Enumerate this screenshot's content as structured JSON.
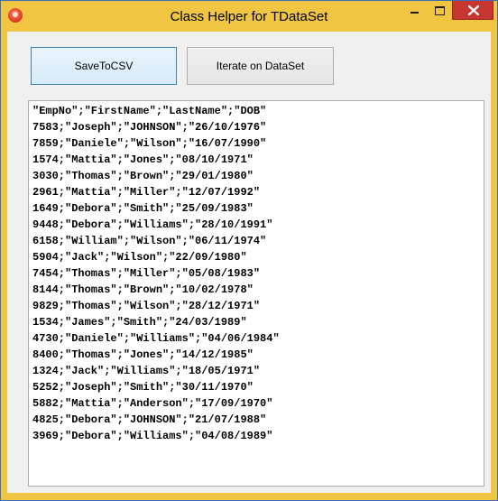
{
  "window": {
    "title": "Class Helper for TDataSet"
  },
  "toolbar": {
    "save_label": "SaveToCSV",
    "iterate_label": "Iterate on DataSet"
  },
  "memo": {
    "lines": [
      "\"EmpNo\";\"FirstName\";\"LastName\";\"DOB\"",
      "7583;\"Joseph\";\"JOHNSON\";\"26/10/1976\"",
      "7859;\"Daniele\";\"Wilson\";\"16/07/1990\"",
      "1574;\"Mattia\";\"Jones\";\"08/10/1971\"",
      "3030;\"Thomas\";\"Brown\";\"29/01/1980\"",
      "2961;\"Mattia\";\"Miller\";\"12/07/1992\"",
      "1649;\"Debora\";\"Smith\";\"25/09/1983\"",
      "9448;\"Debora\";\"Williams\";\"28/10/1991\"",
      "6158;\"William\";\"Wilson\";\"06/11/1974\"",
      "5904;\"Jack\";\"Wilson\";\"22/09/1980\"",
      "7454;\"Thomas\";\"Miller\";\"05/08/1983\"",
      "8144;\"Thomas\";\"Brown\";\"10/02/1978\"",
      "9829;\"Thomas\";\"Wilson\";\"28/12/1971\"",
      "1534;\"James\";\"Smith\";\"24/03/1989\"",
      "4730;\"Daniele\";\"Williams\";\"04/06/1984\"",
      "8400;\"Thomas\";\"Jones\";\"14/12/1985\"",
      "1324;\"Jack\";\"Williams\";\"18/05/1971\"",
      "5252;\"Joseph\";\"Smith\";\"30/11/1970\"",
      "5882;\"Mattia\";\"Anderson\";\"17/09/1970\"",
      "4825;\"Debora\";\"JOHNSON\";\"21/07/1988\"",
      "3969;\"Debora\";\"Williams\";\"04/08/1989\""
    ]
  },
  "colors": {
    "title_bar": "#f0c542",
    "close_button": "#c7372f",
    "client_area": "#f0f0f0"
  }
}
